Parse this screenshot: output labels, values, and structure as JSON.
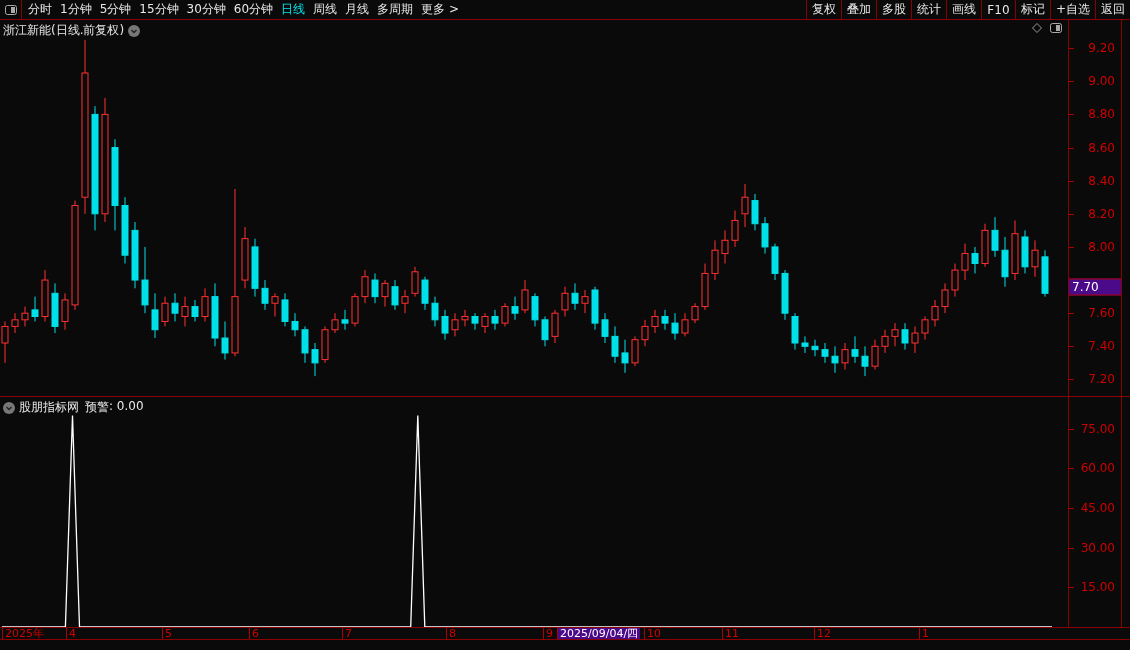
{
  "toolbar": {
    "tabs": [
      {
        "label": "分时",
        "selected": false
      },
      {
        "label": "1分钟",
        "selected": false
      },
      {
        "label": "5分钟",
        "selected": false
      },
      {
        "label": "15分钟",
        "selected": false
      },
      {
        "label": "30分钟",
        "selected": false
      },
      {
        "label": "60分钟",
        "selected": false
      },
      {
        "label": "日线",
        "selected": true
      },
      {
        "label": "周线",
        "selected": false
      },
      {
        "label": "月线",
        "selected": false
      },
      {
        "label": "多周期",
        "selected": false
      },
      {
        "label": "更多 >",
        "selected": false
      }
    ],
    "buttons": [
      "复权",
      "叠加",
      "多股",
      "统计",
      "画线",
      "F10",
      "标记",
      "+自选",
      "返回"
    ]
  },
  "price_pane": {
    "title": "浙江新能(日线.前复权)",
    "current_price": "7.70",
    "chart_data": {
      "type": "candlestick",
      "ylim": [
        7.1,
        9.37
      ],
      "yticks": [
        {
          "value": 9.2,
          "label": "9.20"
        },
        {
          "value": 9.0,
          "label": "9.00"
        },
        {
          "value": 8.8,
          "label": "8.80"
        },
        {
          "value": 8.6,
          "label": "8.60"
        },
        {
          "value": 8.4,
          "label": "8.40"
        },
        {
          "value": 8.2,
          "label": "8.20"
        },
        {
          "value": 8.0,
          "label": "8.00"
        },
        {
          "value": 7.6,
          "label": "7.60"
        },
        {
          "value": 7.4,
          "label": "7.40"
        },
        {
          "value": 7.2,
          "label": "7.20"
        }
      ],
      "ohlc": [
        [
          7.42,
          7.55,
          7.3,
          7.52
        ],
        [
          7.52,
          7.6,
          7.48,
          7.56
        ],
        [
          7.56,
          7.64,
          7.52,
          7.6
        ],
        [
          7.62,
          7.7,
          7.55,
          7.58
        ],
        [
          7.58,
          7.86,
          7.55,
          7.8
        ],
        [
          7.72,
          7.78,
          7.48,
          7.52
        ],
        [
          7.55,
          7.72,
          7.5,
          7.68
        ],
        [
          7.65,
          8.28,
          7.62,
          8.25
        ],
        [
          8.3,
          9.25,
          8.2,
          9.05
        ],
        [
          8.8,
          8.85,
          8.1,
          8.2
        ],
        [
          8.2,
          8.9,
          8.15,
          8.8
        ],
        [
          8.6,
          8.65,
          8.1,
          8.25
        ],
        [
          8.25,
          8.3,
          7.9,
          7.95
        ],
        [
          8.1,
          8.15,
          7.75,
          7.8
        ],
        [
          7.8,
          8.0,
          7.6,
          7.65
        ],
        [
          7.62,
          7.72,
          7.45,
          7.5
        ],
        [
          7.55,
          7.7,
          7.52,
          7.66
        ],
        [
          7.66,
          7.72,
          7.55,
          7.6
        ],
        [
          7.58,
          7.7,
          7.52,
          7.64
        ],
        [
          7.64,
          7.68,
          7.55,
          7.58
        ],
        [
          7.58,
          7.75,
          7.55,
          7.7
        ],
        [
          7.7,
          7.78,
          7.4,
          7.45
        ],
        [
          7.45,
          7.55,
          7.32,
          7.36
        ],
        [
          7.36,
          8.35,
          7.34,
          7.7
        ],
        [
          7.8,
          8.12,
          7.75,
          8.05
        ],
        [
          8.0,
          8.05,
          7.7,
          7.75
        ],
        [
          7.75,
          7.8,
          7.62,
          7.66
        ],
        [
          7.66,
          7.72,
          7.58,
          7.7
        ],
        [
          7.68,
          7.72,
          7.52,
          7.55
        ],
        [
          7.55,
          7.6,
          7.46,
          7.5
        ],
        [
          7.5,
          7.52,
          7.3,
          7.36
        ],
        [
          7.38,
          7.42,
          7.22,
          7.3
        ],
        [
          7.32,
          7.52,
          7.3,
          7.5
        ],
        [
          7.5,
          7.6,
          7.48,
          7.56
        ],
        [
          7.56,
          7.62,
          7.5,
          7.54
        ],
        [
          7.54,
          7.72,
          7.52,
          7.7
        ],
        [
          7.7,
          7.86,
          7.66,
          7.82
        ],
        [
          7.8,
          7.84,
          7.66,
          7.7
        ],
        [
          7.7,
          7.8,
          7.64,
          7.78
        ],
        [
          7.76,
          7.8,
          7.62,
          7.65
        ],
        [
          7.66,
          7.74,
          7.6,
          7.7
        ],
        [
          7.72,
          7.88,
          7.7,
          7.85
        ],
        [
          7.8,
          7.82,
          7.62,
          7.66
        ],
        [
          7.66,
          7.7,
          7.52,
          7.56
        ],
        [
          7.58,
          7.62,
          7.44,
          7.48
        ],
        [
          7.5,
          7.6,
          7.46,
          7.56
        ],
        [
          7.56,
          7.62,
          7.52,
          7.58
        ],
        [
          7.58,
          7.6,
          7.5,
          7.54
        ],
        [
          7.52,
          7.6,
          7.48,
          7.58
        ],
        [
          7.58,
          7.62,
          7.5,
          7.54
        ],
        [
          7.54,
          7.66,
          7.52,
          7.64
        ],
        [
          7.64,
          7.7,
          7.56,
          7.6
        ],
        [
          7.62,
          7.8,
          7.6,
          7.74
        ],
        [
          7.7,
          7.72,
          7.52,
          7.56
        ],
        [
          7.56,
          7.58,
          7.4,
          7.44
        ],
        [
          7.46,
          7.62,
          7.42,
          7.6
        ],
        [
          7.62,
          7.76,
          7.58,
          7.72
        ],
        [
          7.72,
          7.78,
          7.62,
          7.66
        ],
        [
          7.66,
          7.74,
          7.6,
          7.7
        ],
        [
          7.74,
          7.76,
          7.5,
          7.54
        ],
        [
          7.56,
          7.6,
          7.42,
          7.46
        ],
        [
          7.46,
          7.52,
          7.3,
          7.34
        ],
        [
          7.36,
          7.44,
          7.24,
          7.3
        ],
        [
          7.3,
          7.46,
          7.28,
          7.44
        ],
        [
          7.44,
          7.56,
          7.4,
          7.52
        ],
        [
          7.52,
          7.62,
          7.48,
          7.58
        ],
        [
          7.58,
          7.62,
          7.5,
          7.54
        ],
        [
          7.54,
          7.6,
          7.44,
          7.48
        ],
        [
          7.48,
          7.6,
          7.46,
          7.56
        ],
        [
          7.56,
          7.66,
          7.54,
          7.64
        ],
        [
          7.64,
          7.9,
          7.62,
          7.84
        ],
        [
          7.84,
          8.04,
          7.8,
          7.98
        ],
        [
          7.96,
          8.1,
          7.9,
          8.04
        ],
        [
          8.04,
          8.22,
          8.0,
          8.16
        ],
        [
          8.2,
          8.38,
          8.12,
          8.3
        ],
        [
          8.28,
          8.32,
          8.1,
          8.14
        ],
        [
          8.14,
          8.18,
          7.96,
          8.0
        ],
        [
          8.0,
          8.02,
          7.8,
          7.84
        ],
        [
          7.84,
          7.86,
          7.56,
          7.6
        ],
        [
          7.58,
          7.6,
          7.38,
          7.42
        ],
        [
          7.42,
          7.46,
          7.36,
          7.4
        ],
        [
          7.4,
          7.44,
          7.34,
          7.38
        ],
        [
          7.38,
          7.42,
          7.3,
          7.34
        ],
        [
          7.34,
          7.4,
          7.24,
          7.3
        ],
        [
          7.3,
          7.42,
          7.26,
          7.38
        ],
        [
          7.38,
          7.46,
          7.3,
          7.34
        ],
        [
          7.34,
          7.4,
          7.22,
          7.28
        ],
        [
          7.28,
          7.44,
          7.26,
          7.4
        ],
        [
          7.4,
          7.5,
          7.36,
          7.46
        ],
        [
          7.46,
          7.54,
          7.4,
          7.5
        ],
        [
          7.5,
          7.54,
          7.38,
          7.42
        ],
        [
          7.42,
          7.52,
          7.36,
          7.48
        ],
        [
          7.48,
          7.58,
          7.44,
          7.56
        ],
        [
          7.56,
          7.68,
          7.52,
          7.64
        ],
        [
          7.64,
          7.78,
          7.6,
          7.74
        ],
        [
          7.74,
          7.9,
          7.7,
          7.86
        ],
        [
          7.86,
          8.02,
          7.8,
          7.96
        ],
        [
          7.96,
          8.0,
          7.84,
          7.9
        ],
        [
          7.9,
          8.14,
          7.88,
          8.1
        ],
        [
          8.1,
          8.18,
          7.94,
          7.98
        ],
        [
          7.98,
          8.06,
          7.76,
          7.82
        ],
        [
          7.84,
          8.16,
          7.8,
          8.08
        ],
        [
          8.06,
          8.1,
          7.84,
          7.88
        ],
        [
          7.88,
          8.04,
          7.82,
          7.98
        ],
        [
          7.94,
          7.98,
          7.7,
          7.72
        ]
      ]
    }
  },
  "indicator_pane": {
    "name": "股朋指标网",
    "alert_value": ": 0.00",
    "chart_data": {
      "type": "line",
      "ylim": [
        0,
        87
      ],
      "yticks": [
        {
          "value": 75,
          "label": "75.00"
        },
        {
          "value": 60,
          "label": "60.00"
        },
        {
          "value": 45,
          "label": "45.00"
        },
        {
          "value": 30,
          "label": "30.00"
        },
        {
          "value": 15,
          "label": "15.00"
        }
      ],
      "series": [
        {
          "name": "预警",
          "color": "#ffffff",
          "values": [
            0,
            0,
            0,
            0,
            0,
            0,
            0,
            0,
            0,
            0,
            80,
            0,
            0,
            0,
            0,
            0,
            0,
            0,
            0,
            0,
            0,
            0,
            0,
            0,
            0,
            0,
            0,
            0,
            0,
            0,
            0,
            0,
            0,
            0,
            0,
            0,
            0,
            0,
            0,
            0,
            0,
            0,
            0,
            0,
            0,
            0,
            0,
            0,
            0,
            0,
            0,
            0,
            0,
            0,
            0,
            0,
            0,
            0,
            0,
            80,
            0,
            0,
            0,
            0,
            0,
            0,
            0,
            0,
            0,
            0,
            0,
            0,
            0,
            0,
            0,
            0,
            0,
            0,
            0,
            0,
            0,
            0,
            0,
            0,
            0,
            0,
            0,
            0,
            0,
            0,
            0,
            0,
            0,
            0,
            0,
            0,
            0,
            0,
            0,
            0,
            0,
            0,
            0,
            0,
            0,
            0,
            0,
            0,
            0,
            0,
            0,
            0,
            0,
            0,
            0,
            0,
            0,
            0,
            0,
            0,
            0,
            0,
            0,
            0,
            0,
            0,
            0,
            0,
            0,
            0,
            0,
            0,
            0,
            0,
            0,
            0,
            0,
            0,
            0,
            0,
            0,
            0,
            0,
            0,
            0,
            0,
            0,
            0,
            0,
            0
          ]
        }
      ]
    }
  },
  "date_axis": {
    "labels": [
      {
        "text": "2025年",
        "selected": false
      },
      {
        "text": "4",
        "selected": false
      },
      {
        "text": "5",
        "selected": false
      },
      {
        "text": "6",
        "selected": false
      },
      {
        "text": "7",
        "selected": false
      },
      {
        "text": "8",
        "selected": false
      },
      {
        "text": "9",
        "selected": false
      },
      {
        "text": "2025/09/04/四",
        "selected": true
      },
      {
        "text": "10",
        "selected": false
      },
      {
        "text": "11",
        "selected": false
      },
      {
        "text": "12",
        "selected": false
      },
      {
        "text": "1",
        "selected": false
      }
    ]
  }
}
